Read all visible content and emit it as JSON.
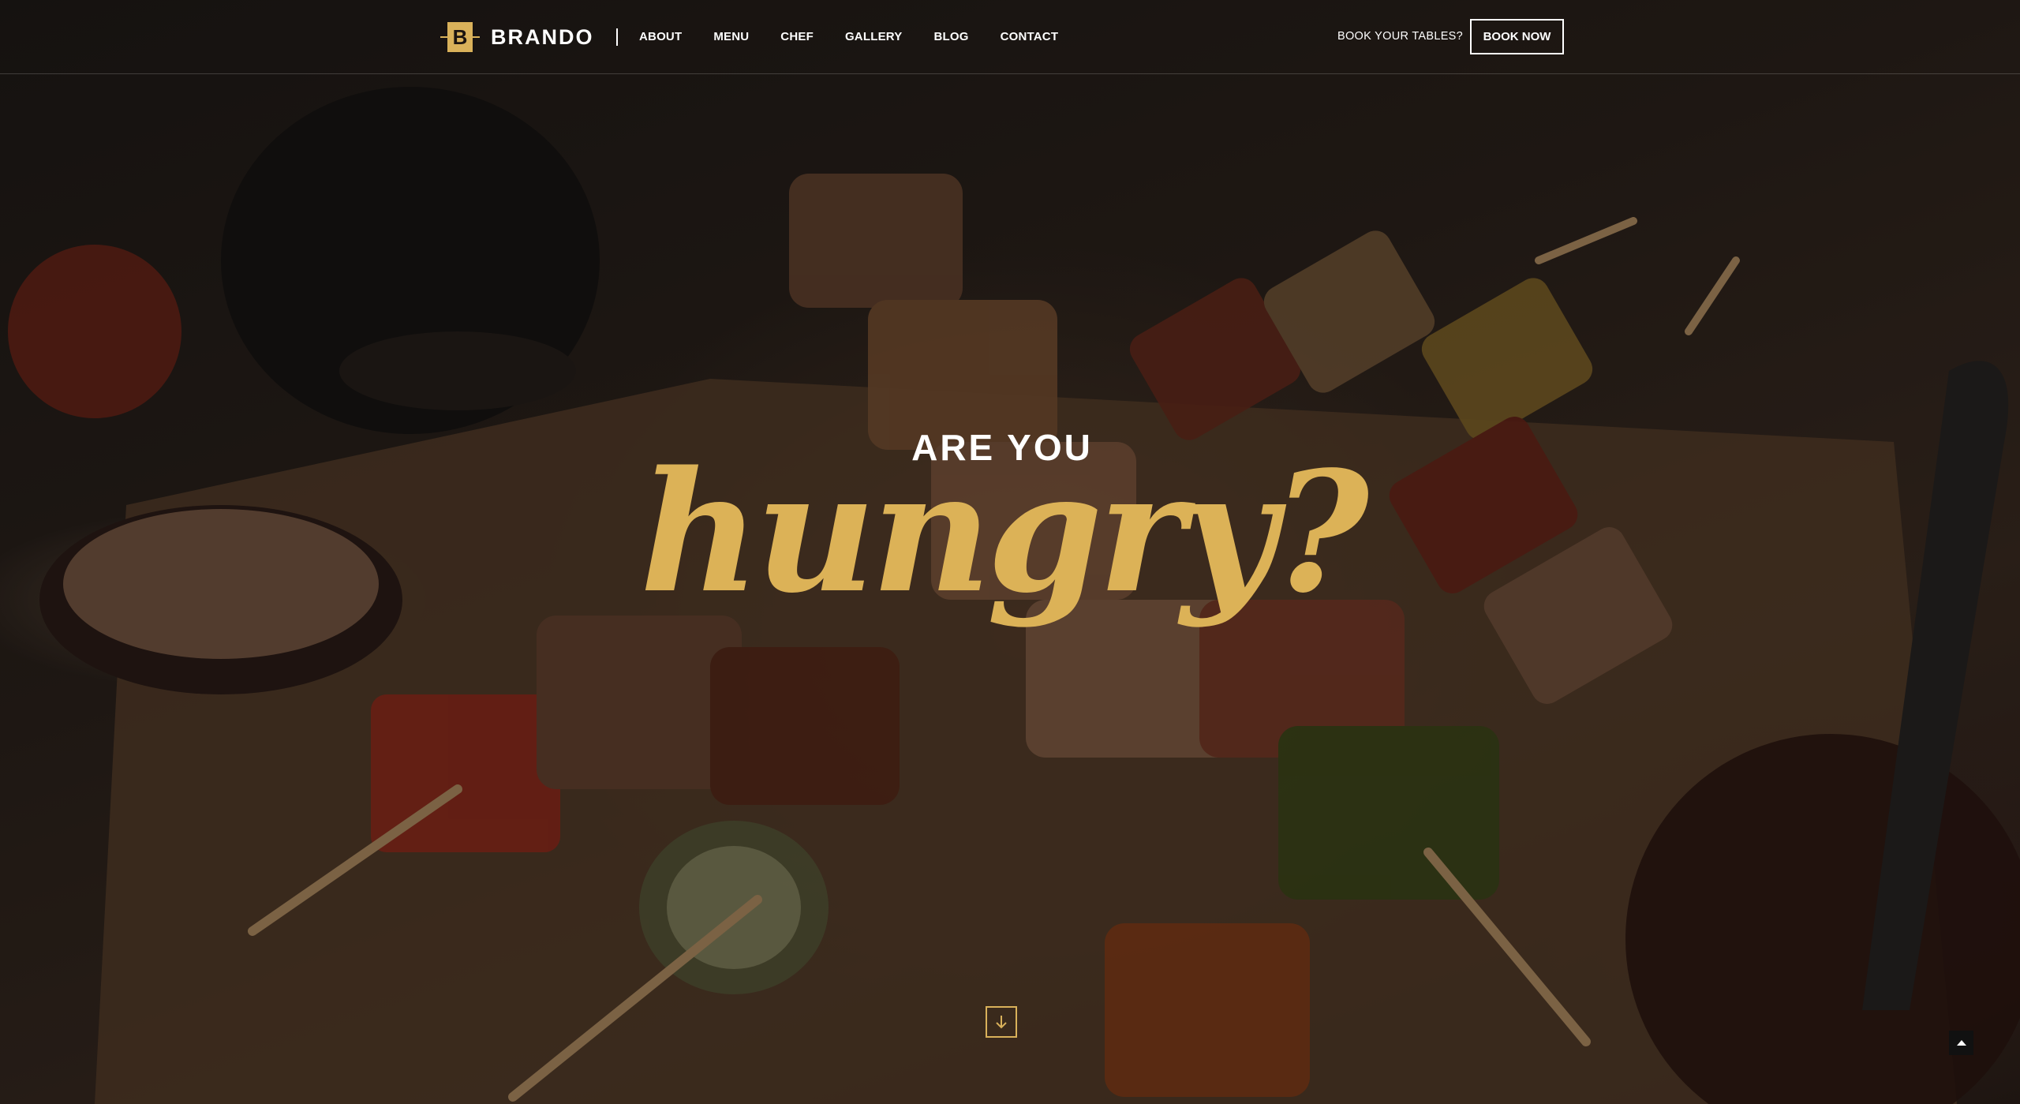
{
  "brand": {
    "logo_letter": "B",
    "name": "BRANDO",
    "accent_color": "#d9b15a"
  },
  "nav": {
    "items": [
      {
        "label": "ABOUT"
      },
      {
        "label": "MENU"
      },
      {
        "label": "CHEF"
      },
      {
        "label": "GALLERY"
      },
      {
        "label": "BLOG"
      },
      {
        "label": "CONTACT"
      }
    ],
    "book_prompt": "BOOK YOUR TABLES?",
    "book_button": "BOOK NOW"
  },
  "hero": {
    "eyebrow": "ARE YOU",
    "headline": "hungry?",
    "background": "grilled-kebab-skewers-photo"
  },
  "icons": {
    "scroll_down": "arrow-down-icon",
    "back_to_top": "chevron-up-icon"
  }
}
